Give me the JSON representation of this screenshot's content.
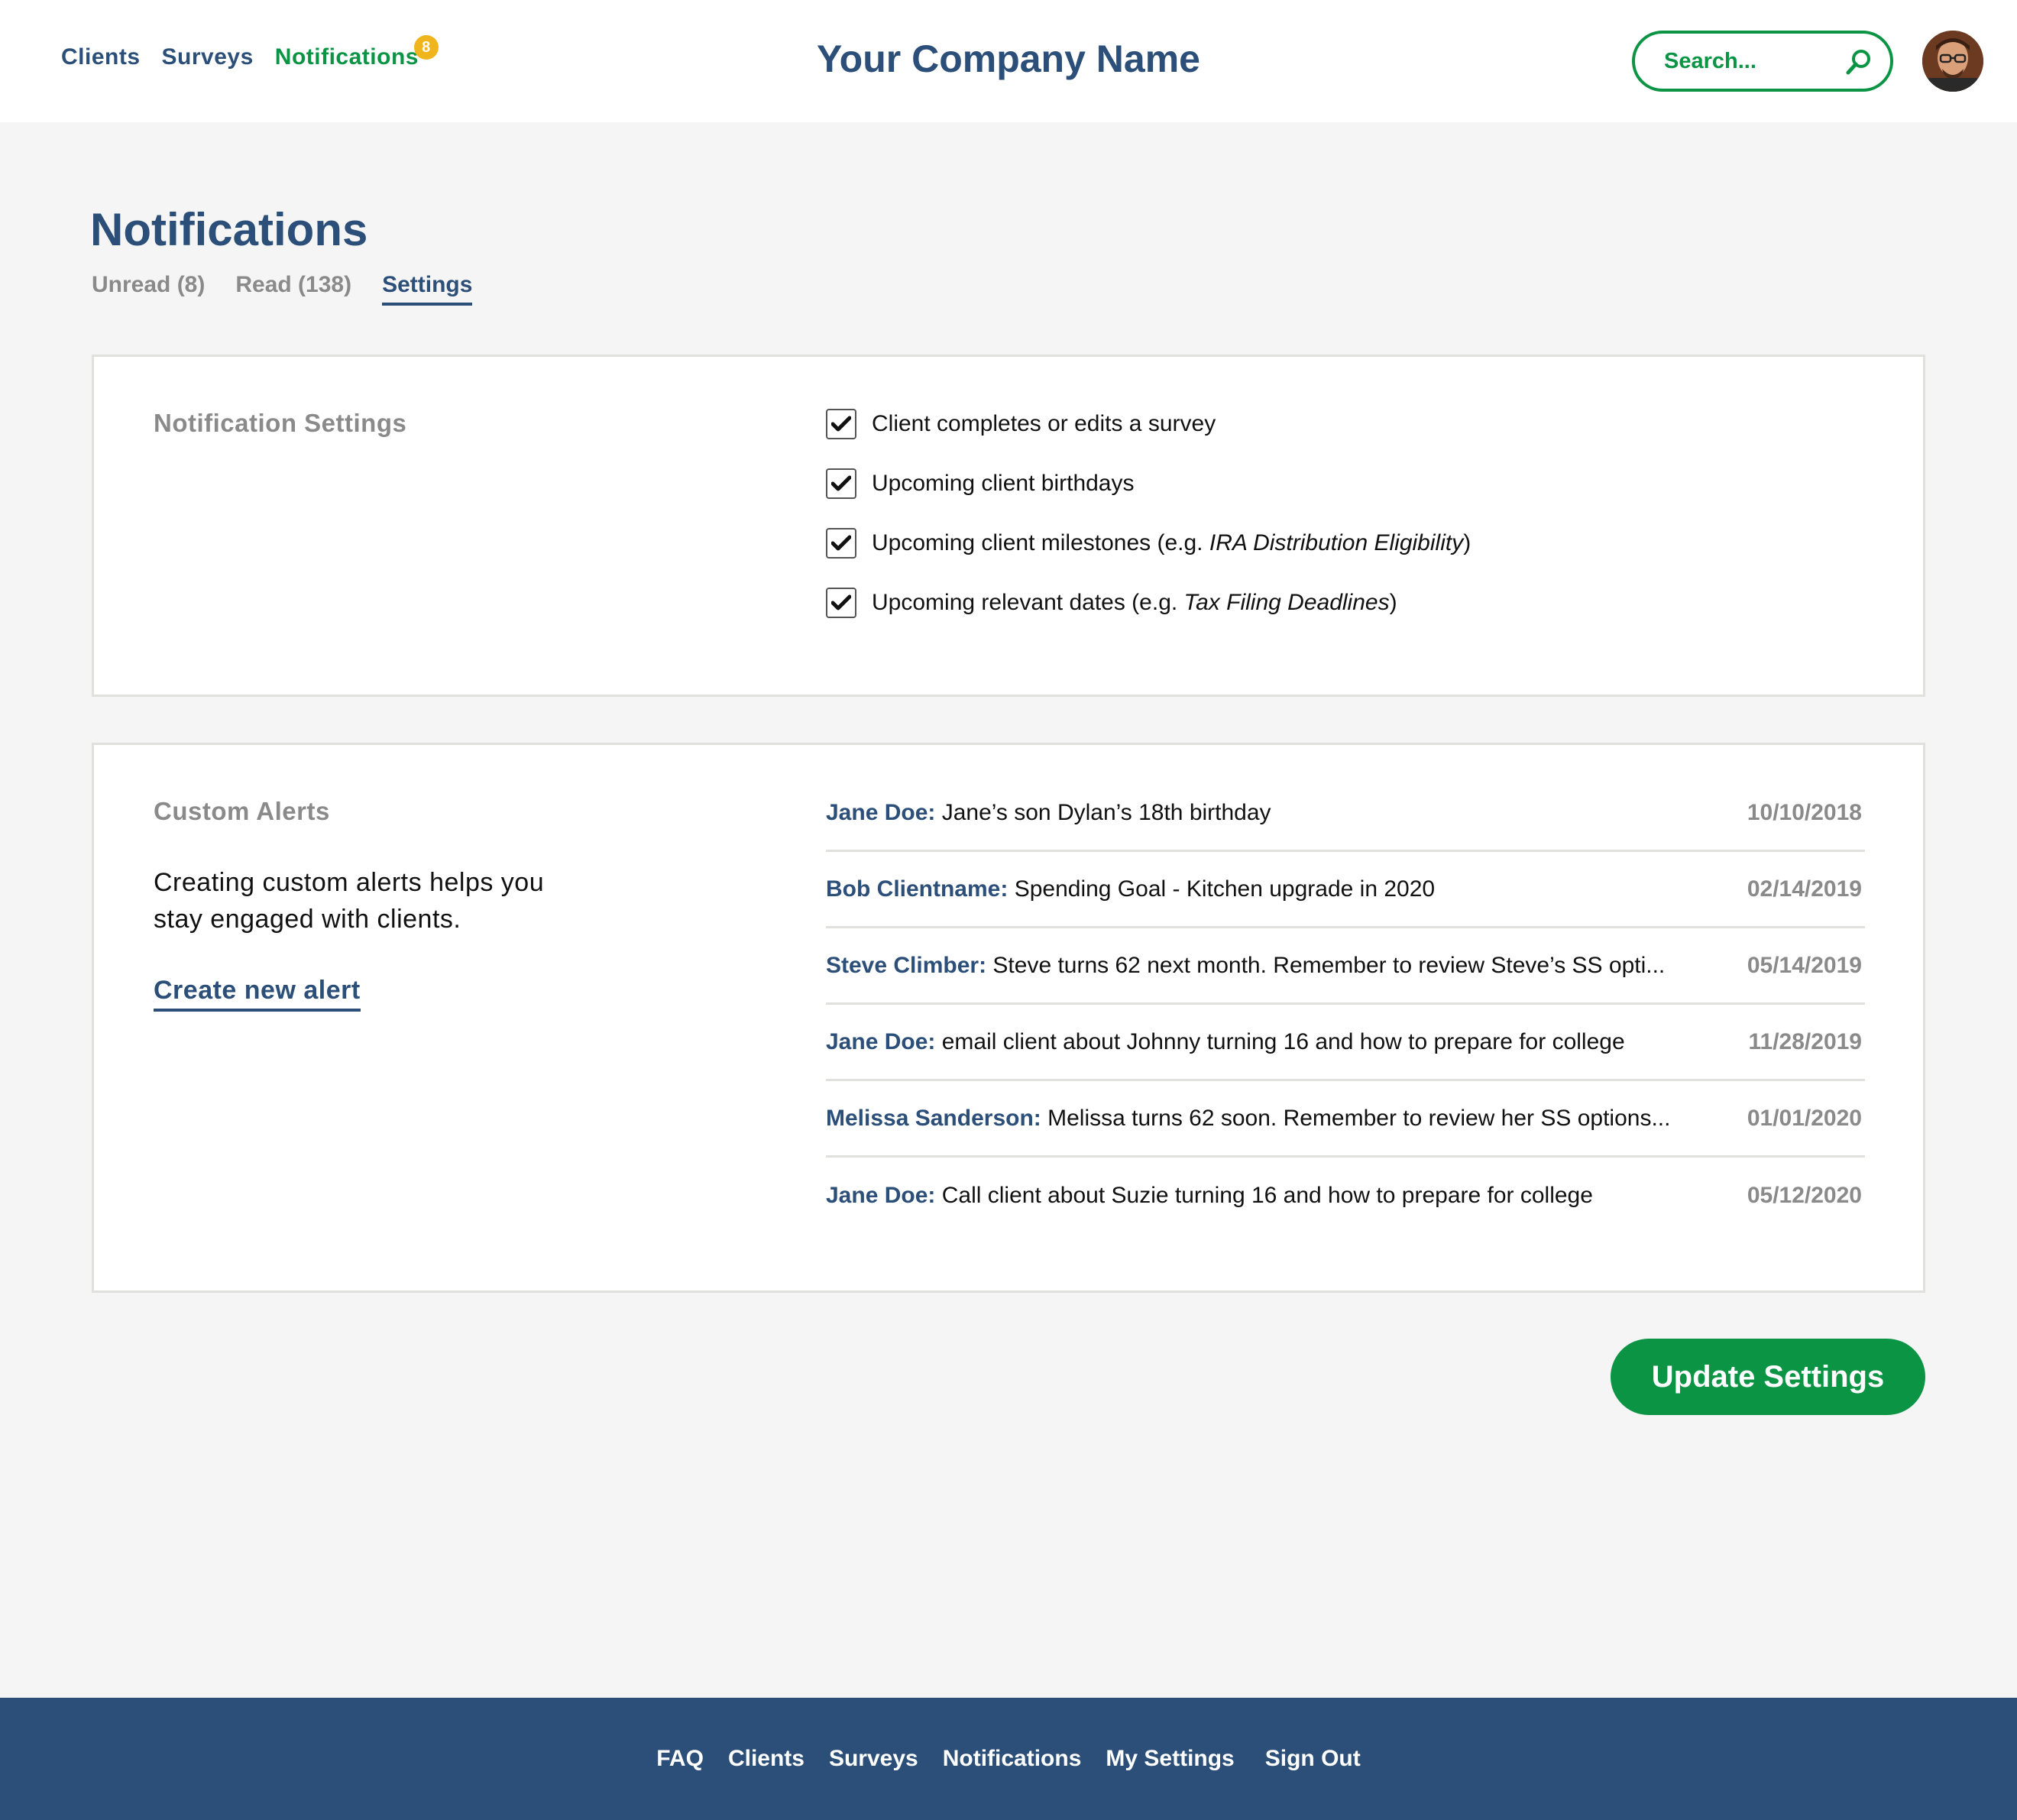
{
  "header": {
    "nav": [
      {
        "label": "Clients"
      },
      {
        "label": "Surveys"
      },
      {
        "label": "Notifications",
        "badge": "8"
      }
    ],
    "company_name": "Your Company Name",
    "search_placeholder": "Search...",
    "avatar": "user-avatar"
  },
  "page": {
    "title": "Notifications",
    "tabs": [
      {
        "label": "Unread (8)"
      },
      {
        "label": "Read (138)"
      },
      {
        "label": "Settings",
        "active": true
      }
    ]
  },
  "notification_settings": {
    "title": "Notification Settings",
    "options": [
      {
        "label": "Client completes or edits a survey",
        "checked": true
      },
      {
        "label": "Upcoming client birthdays",
        "checked": true
      },
      {
        "label_prefix": "Upcoming client milestones (e.g. ",
        "label_italic": "IRA Distribution Eligibility",
        "label_suffix": ")",
        "checked": true
      },
      {
        "label_prefix": "Upcoming relevant dates (e.g. ",
        "label_italic": "Tax Filing Deadlines",
        "label_suffix": ")",
        "checked": true
      }
    ]
  },
  "custom_alerts": {
    "title": "Custom Alerts",
    "description": "Creating custom alerts helps you stay engaged with clients.",
    "create_link": "Create new alert",
    "alerts": [
      {
        "name": "Jane Doe:",
        "text": " Jane’s son Dylan’s 18th birthday",
        "date": "10/10/2018"
      },
      {
        "name": "Bob Clientname:",
        "text": " Spending Goal - Kitchen upgrade in 2020",
        "date": "02/14/2019"
      },
      {
        "name": "Steve Climber:",
        "text": " Steve turns 62 next month. Remember to review Steve’s SS opti...",
        "date": "05/14/2019"
      },
      {
        "name": "Jane Doe:",
        "text": " email client about Johnny turning 16 and how to prepare for college",
        "date": "11/28/2019"
      },
      {
        "name": "Melissa Sanderson:",
        "text": " Melissa turns 62 soon. Remember to review her SS options...",
        "date": "01/01/2020"
      },
      {
        "name": "Jane Doe:",
        "text": " Call client about Suzie turning 16 and how to prepare for college",
        "date": "05/12/2020"
      }
    ]
  },
  "actions": {
    "update_button": "Update Settings"
  },
  "footer": {
    "links": [
      "FAQ",
      "Clients",
      "Surveys",
      "Notifications",
      "My Settings",
      "Sign Out"
    ]
  },
  "colors": {
    "brand_blue": "#2b4f78",
    "brand_green": "#0b9444",
    "badge_yellow": "#f0b41c",
    "muted_gray": "#8a8a8a",
    "background": "#f5f5f5"
  }
}
